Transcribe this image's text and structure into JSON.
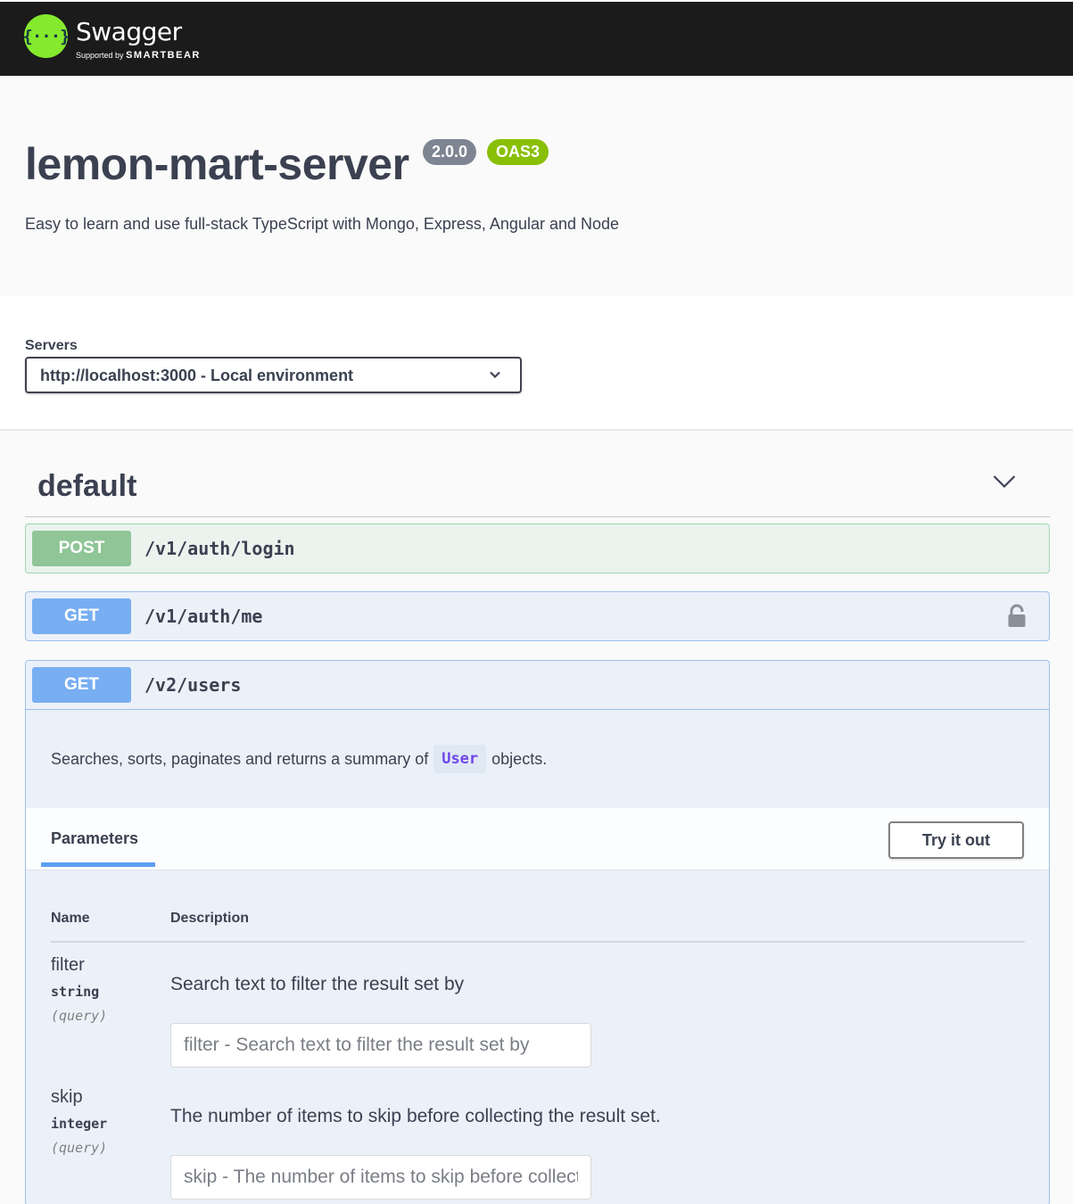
{
  "topbar": {
    "logo_glyph": "{···}",
    "brand": "Swagger",
    "supported_by": "Supported by",
    "company": "SMARTBEAR"
  },
  "info": {
    "title": "lemon-mart-server",
    "version": "2.0.0",
    "oas_badge": "OAS3",
    "description": "Easy to learn and use full-stack TypeScript with Mongo, Express, Angular and Node"
  },
  "servers": {
    "label": "Servers",
    "selected": "http://localhost:3000 - Local environment"
  },
  "tag": {
    "name": "default",
    "toggle_icon": "chevron-down-icon"
  },
  "operations": [
    {
      "method": "POST",
      "path": "/v1/auth/login",
      "color": "#49cc90"
    },
    {
      "method": "GET",
      "path": "/v1/auth/me",
      "color": "#61affe",
      "lock_icon": "lock-icon"
    },
    {
      "method": "GET",
      "path": "/v2/users",
      "color": "#61affe",
      "description_before": "Searches, sorts, paginates and returns a summary of",
      "description_code": "User",
      "description_after": "objects."
    }
  ],
  "parameters": {
    "tab_label": "Parameters",
    "try_it_out": "Try it out",
    "col_name": "Name",
    "col_description": "Description",
    "items": [
      {
        "name": "filter",
        "type": "string",
        "in": "(query)",
        "description": "Search text to filter the result set by",
        "placeholder": "filter - Search text to filter the result set by"
      },
      {
        "name": "skip",
        "type": "integer",
        "in": "(query)",
        "description": "The number of items to skip before collecting the result set.",
        "placeholder": "skip - The number of items to skip before collecting the result set."
      }
    ]
  }
}
